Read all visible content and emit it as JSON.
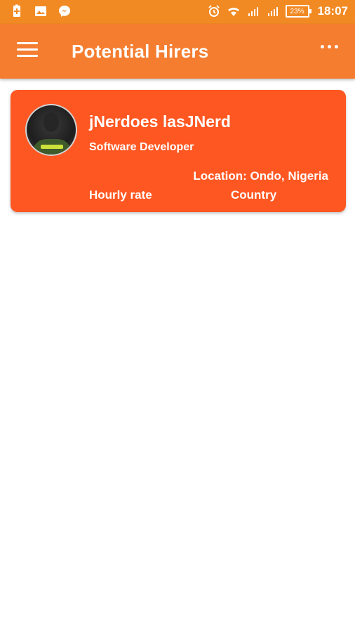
{
  "status_bar": {
    "time": "18:07",
    "battery": "23%",
    "left_icons": [
      "battery-saver-icon",
      "image-icon",
      "messenger-icon"
    ],
    "right_icons": [
      "alarm-icon",
      "wifi-icon",
      "signal-icon",
      "signal-icon"
    ]
  },
  "app_bar": {
    "title": "Potential Hirers"
  },
  "card": {
    "name": "jNerdoes lasJNerd",
    "role": "Software Developer",
    "location": "Location: Ondo, Nigeria",
    "hourly_rate_label": "Hourly rate",
    "country_label": "Country"
  },
  "colors": {
    "status_bar": "#f28a24",
    "app_bar": "#f47d30",
    "card": "#ff5722"
  }
}
